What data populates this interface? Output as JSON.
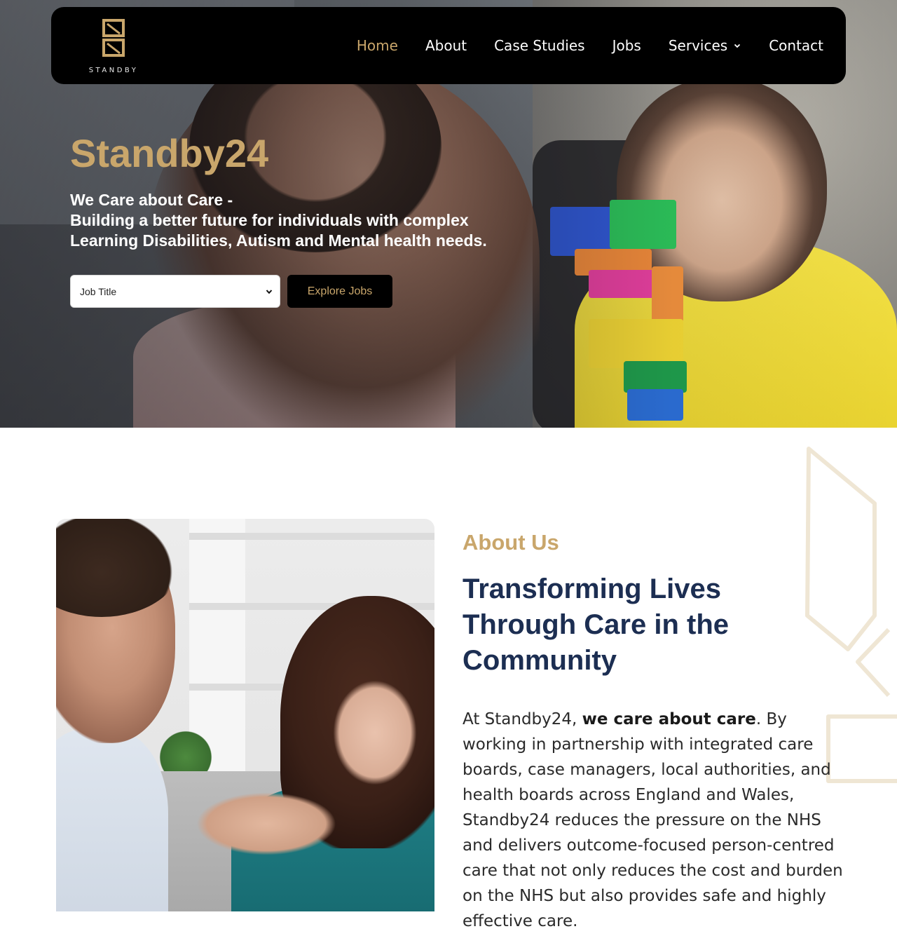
{
  "nav": {
    "logo_text": "STANDBY",
    "items": [
      {
        "label": "Home",
        "active": true
      },
      {
        "label": "About",
        "active": false
      },
      {
        "label": "Case Studies",
        "active": false
      },
      {
        "label": "Jobs",
        "active": false
      },
      {
        "label": "Services",
        "active": false,
        "has_dropdown": true
      },
      {
        "label": "Contact",
        "active": false
      }
    ]
  },
  "hero": {
    "title": "Standby24",
    "subtitle_line1": "We Care about Care -",
    "subtitle_line2": "Building a better future for individuals with complex",
    "subtitle_line3": "Learning Disabilities, Autism and Mental health needs.",
    "job_select": {
      "selected": "Job Title"
    },
    "explore_button": "Explore Jobs"
  },
  "about": {
    "eyebrow": "About Us",
    "headline": "Transforming Lives Through Care in the Community",
    "para_intro": "At Standby24, ",
    "para_bold": "we care about care",
    "para_rest": ". By working in partnership with integrated care boards, case managers, local authorities, and health boards across England and Wales, Standby24 reduces the pressure on the NHS and delivers outcome-focused person-centred care that not only reduces the cost and burden on the NHS but also provides safe and highly effective care."
  },
  "colors": {
    "accent_gold": "#c9a66b",
    "nav_background": "#000000",
    "headline_navy": "#1c2e52",
    "text_dark": "#2a2a2a"
  },
  "icons": [
    "logo-8-mark",
    "chevron-down-icon",
    "select-chevron-icon"
  ]
}
